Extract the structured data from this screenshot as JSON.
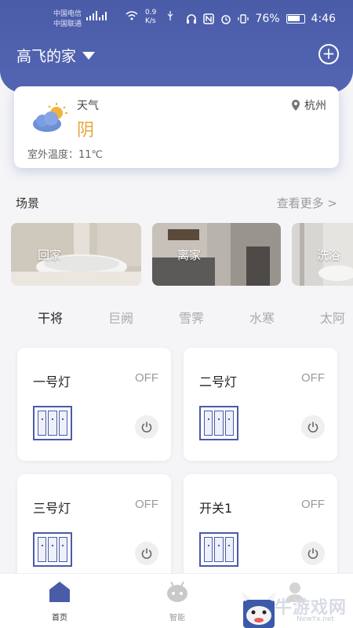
{
  "status_bar": {
    "carrier1": "中国电信",
    "carrier2": "中国联通",
    "net_speed": "0.9",
    "net_unit": "K/s",
    "battery": "76%",
    "time": "4:46"
  },
  "header": {
    "home_name": "高飞的家",
    "add_icon": "plus-circle-icon"
  },
  "weather": {
    "label": "天气",
    "value": "阴",
    "outdoor_temp": "室外温度：11℃",
    "city": "杭州",
    "value_color": "#e8a43c"
  },
  "scenes": {
    "title": "场景",
    "see_more": "查看更多 >",
    "items": [
      {
        "label": "回家"
      },
      {
        "label": "离家"
      },
      {
        "label": "洗浴"
      }
    ]
  },
  "tabs": [
    {
      "label": "干将",
      "active": true
    },
    {
      "label": "巨阙",
      "active": false
    },
    {
      "label": "雪霁",
      "active": false
    },
    {
      "label": "水寒",
      "active": false
    },
    {
      "label": "太阿",
      "active": false
    }
  ],
  "devices": [
    {
      "name": "一号灯",
      "status": "OFF"
    },
    {
      "name": "二号灯",
      "status": "OFF"
    },
    {
      "name": "三号灯",
      "status": "OFF"
    },
    {
      "name": "开关1",
      "status": "OFF"
    }
  ],
  "bottom_nav": {
    "items": [
      {
        "label": "首页",
        "icon": "home-icon",
        "active": true
      },
      {
        "label": "智能",
        "icon": "robot-icon",
        "active": false
      }
    ]
  },
  "watermark": {
    "text": "牛游戏网",
    "url": "NewYx.net"
  },
  "colors": {
    "brand": "#4a5ba8",
    "accent": "#e8a43c"
  }
}
